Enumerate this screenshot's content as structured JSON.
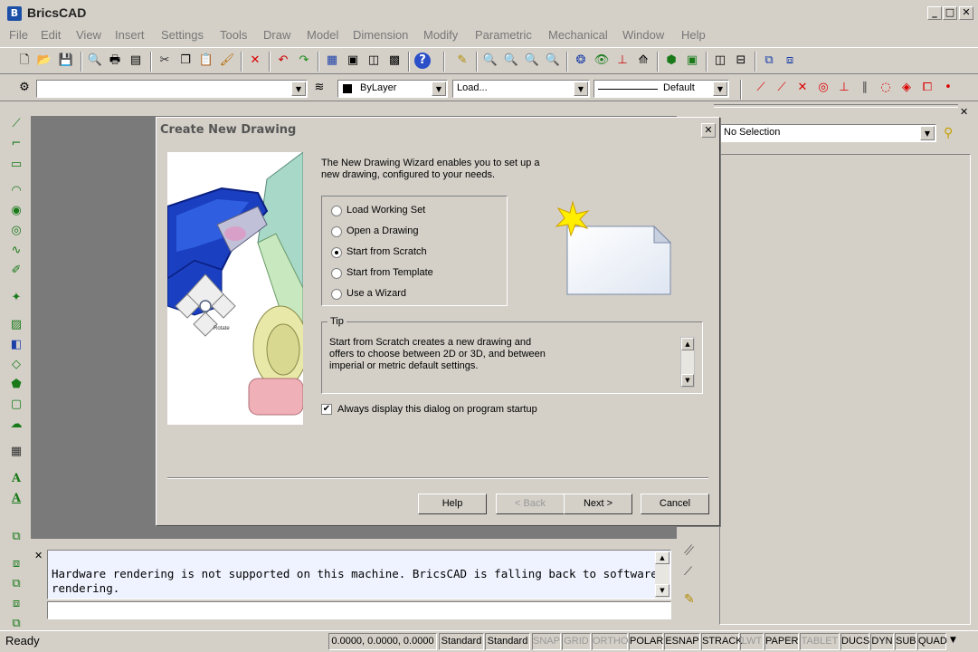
{
  "app": {
    "title": "BricsCAD",
    "icon_letter": "B"
  },
  "menu": [
    "File",
    "Edit",
    "View",
    "Insert",
    "Settings",
    "Tools",
    "Draw",
    "Model",
    "Dimension",
    "Modify",
    "Parametric",
    "Mechanical",
    "Window",
    "Help"
  ],
  "toolbar2": {
    "layer_value": "",
    "color_value": "ByLayer",
    "linetype_value": "Load...",
    "lineweight_value": "Default"
  },
  "properties": {
    "selection": "No Selection"
  },
  "dialog": {
    "title": "Create New Drawing",
    "intro": "The New Drawing Wizard enables you to set up a new drawing, configured to your needs.",
    "options": [
      {
        "label": "Load Working Set",
        "selected": false
      },
      {
        "label": "Open a Drawing",
        "selected": false
      },
      {
        "label": "Start from Scratch",
        "selected": true
      },
      {
        "label": "Start from Template",
        "selected": false
      },
      {
        "label": "Use a Wizard",
        "selected": false
      }
    ],
    "tip_legend": "Tip",
    "tip_text": "Start from Scratch creates a new drawing and offers to choose between 2D or 3D, and between imperial or metric default settings.",
    "always_display_label": "Always display this dialog on program startup",
    "always_display_checked": true,
    "image_widget_label": "Rotate",
    "buttons": {
      "help": "Help",
      "back": "< Back",
      "next": "Next >",
      "cancel": "Cancel"
    }
  },
  "command_line": {
    "output": "Hardware rendering is not supported on this machine. BricsCAD is falling back to software rendering."
  },
  "status": {
    "ready": "Ready",
    "coords": "0.0000, 0.0000, 0.0000",
    "cells": [
      "Standard",
      "Standard",
      "SNAP",
      "GRID",
      "ORTHO",
      "POLAR",
      "ESNAP",
      "STRACK",
      "LWT",
      "PAPER",
      "TABLET",
      "DUCS",
      "DYN",
      "SUB",
      "QUAD"
    ],
    "disabled_cells": [
      "SNAP",
      "GRID",
      "ORTHO",
      "LWT",
      "TABLET"
    ]
  }
}
